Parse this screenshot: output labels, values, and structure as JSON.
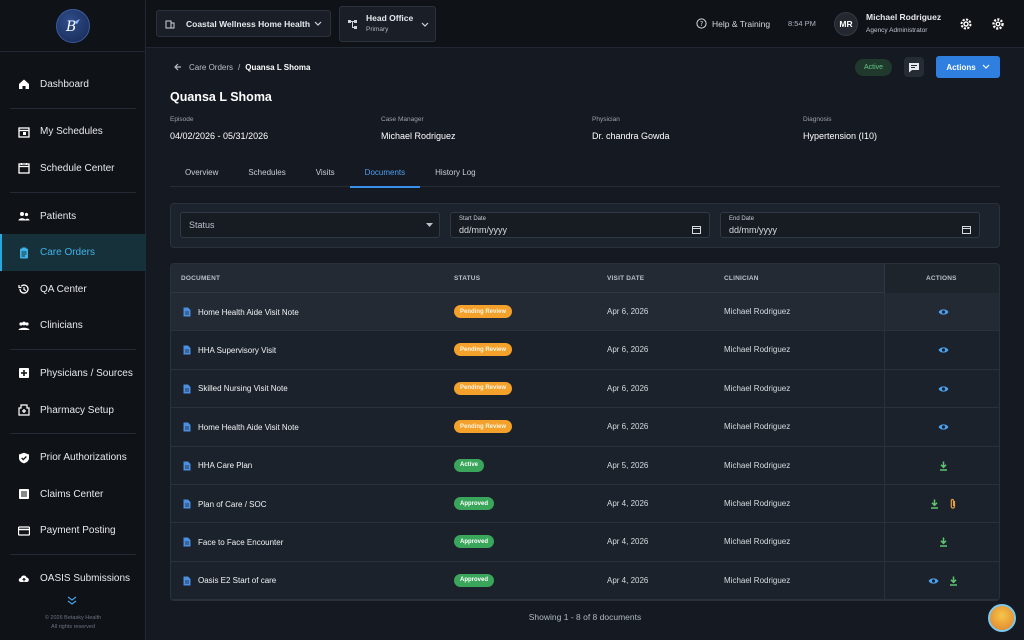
{
  "sidebar": {
    "logo": "B",
    "items": [
      {
        "label": "Dashboard",
        "icon": "home-icon"
      },
      {
        "label": "My Schedules",
        "icon": "calendar-check-icon"
      },
      {
        "label": "Schedule Center",
        "icon": "calendar-icon"
      },
      {
        "label": "Patients",
        "icon": "users-icon"
      },
      {
        "label": "Care Orders",
        "icon": "clipboard-icon",
        "active": true
      },
      {
        "label": "QA Center",
        "icon": "history-icon"
      },
      {
        "label": "Clinicians",
        "icon": "group-icon"
      },
      {
        "label": "Physicians / Sources",
        "icon": "plus-box-icon"
      },
      {
        "label": "Pharmacy Setup",
        "icon": "pharmacy-icon"
      },
      {
        "label": "Prior Authorizations",
        "icon": "shield-check-icon"
      },
      {
        "label": "Claims Center",
        "icon": "list-icon"
      },
      {
        "label": "Payment Posting",
        "icon": "card-icon"
      },
      {
        "label": "OASIS Submissions",
        "icon": "cloud-upload-icon"
      }
    ],
    "footer_line1": "© 2026 Betasky Health",
    "footer_line2": "All rights reserved"
  },
  "topbar": {
    "agency": "Coastal Wellness Home Health",
    "office_name": "Head Office",
    "office_sub": "Primary",
    "help": "Help & Training",
    "time": "8:54 PM",
    "avatar": "MR",
    "user_name": "Michael Rodriguez",
    "user_role": "Agency Administrator"
  },
  "main": {
    "breadcrumb_parent": "Care Orders",
    "breadcrumb_current": "Quansa L Shoma",
    "status": "Active",
    "actions_label": "Actions",
    "patient_name": "Quansa L Shoma",
    "meta": {
      "episode_label": "Episode",
      "episode": "04/02/2026 - 05/31/2026",
      "manager_label": "Case Manager",
      "manager": "Michael Rodriguez",
      "physician_label": "Physician",
      "physician": "Dr. chandra Gowda",
      "diagnosis_label": "Diagnosis",
      "diagnosis": "Hypertension (I10)"
    },
    "tabs": [
      "Overview",
      "Schedules",
      "Visits",
      "Documents",
      "History Log"
    ],
    "filters": {
      "status_placeholder": "Status",
      "start_label": "Start Date",
      "start_value": "dd/mm/yyyy",
      "end_label": "End Date",
      "end_value": "dd/mm/yyyy"
    },
    "table": {
      "headers": [
        "DOCUMENT",
        "STATUS",
        "VISIT DATE",
        "CLINICIAN",
        "ACTIONS"
      ],
      "rows": [
        {
          "doc": "Home Health Aide Visit Note",
          "status": "Pending Review",
          "kind": "pending",
          "date": "Apr 6, 2026",
          "clinician": "Michael Rodriguez",
          "actions": [
            "view"
          ]
        },
        {
          "doc": "HHA Supervisory Visit",
          "status": "Pending Review",
          "kind": "pending",
          "date": "Apr 6, 2026",
          "clinician": "Michael Rodriguez",
          "actions": [
            "view"
          ]
        },
        {
          "doc": "Skilled Nursing Visit Note",
          "status": "Pending Review",
          "kind": "pending",
          "date": "Apr 6, 2026",
          "clinician": "Michael Rodriguez",
          "actions": [
            "view"
          ]
        },
        {
          "doc": "Home Health Aide Visit Note",
          "status": "Pending Review",
          "kind": "pending",
          "date": "Apr 6, 2026",
          "clinician": "Michael Rodriguez",
          "actions": [
            "view"
          ]
        },
        {
          "doc": "HHA Care Plan",
          "status": "Active",
          "kind": "active",
          "date": "Apr 5, 2026",
          "clinician": "Michael Rodriguez",
          "actions": [
            "download"
          ]
        },
        {
          "doc": "Plan of Care / SOC",
          "status": "Approved",
          "kind": "approved",
          "date": "Apr 4, 2026",
          "clinician": "Michael Rodriguez",
          "actions": [
            "download",
            "attach"
          ]
        },
        {
          "doc": "Face to Face Encounter",
          "status": "Approved",
          "kind": "approved",
          "date": "Apr 4, 2026",
          "clinician": "Michael Rodriguez",
          "actions": [
            "download"
          ]
        },
        {
          "doc": "Oasis E2 Start of care",
          "status": "Approved",
          "kind": "approved",
          "date": "Apr 4, 2026",
          "clinician": "Michael Rodriguez",
          "actions": [
            "view",
            "download"
          ]
        }
      ]
    },
    "count_text": "Showing 1 - 8 of 8 documents"
  },
  "colors": {
    "accent": "#2f7fe0",
    "pending": "#f3a12a",
    "approved": "#3aa65b",
    "active_nav": "#3fb3e8"
  }
}
